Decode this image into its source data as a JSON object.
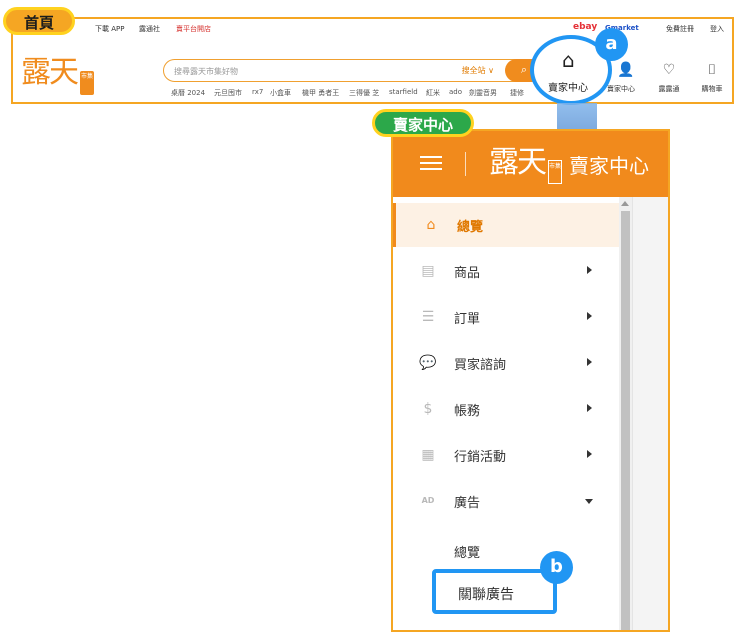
{
  "home": {
    "tag": "首頁",
    "top_links": [
      "下載 APP",
      "露通社",
      "賣平台開店"
    ],
    "top_right": [
      "ebay",
      "Gmarket",
      "免費註冊",
      "登入"
    ],
    "logo": "露天",
    "logo_badge": "市集",
    "search": {
      "placeholder": "搜尋露天市集好物",
      "scope": "搜全站 ∨"
    },
    "hot_keywords": [
      "桌曆 2024",
      "元旦囤市",
      "rx7",
      "小盒車",
      "機甲 勇者王",
      "三得優 芝",
      "starfield",
      "紅米",
      "ado",
      "劍靈音男",
      "捷修"
    ],
    "nav": [
      {
        "label": "賣家中心",
        "icon": "⌂"
      },
      {
        "label": "露露通",
        "icon": "♡"
      },
      {
        "label": "購物車",
        "icon": "🛒"
      }
    ],
    "account_icon": "👤",
    "seller_center_label": "賣家中心",
    "badge_a": "a"
  },
  "seller": {
    "tag": "賣家中心",
    "header_logo": "露天",
    "header_logo_badge": "市集",
    "header_title": "賣家中心",
    "menu": [
      {
        "label": "總覽",
        "icon": "home-icon",
        "glyph": "⌂",
        "active": true
      },
      {
        "label": "商品",
        "icon": "basket-icon",
        "glyph": "▤"
      },
      {
        "label": "訂單",
        "icon": "order-list-icon",
        "glyph": "☰"
      },
      {
        "label": "買家諮詢",
        "icon": "chat-icon",
        "glyph": "💬"
      },
      {
        "label": "帳務",
        "icon": "money-icon",
        "glyph": "$"
      },
      {
        "label": "行銷活動",
        "icon": "calendar-icon",
        "glyph": "▦"
      },
      {
        "label": "廣告",
        "icon": "ad-icon",
        "glyph": "AD",
        "expanded": true
      }
    ],
    "submenu": {
      "overview": "總覽",
      "related_ads": "關聯廣告"
    },
    "badge_b": "b"
  }
}
